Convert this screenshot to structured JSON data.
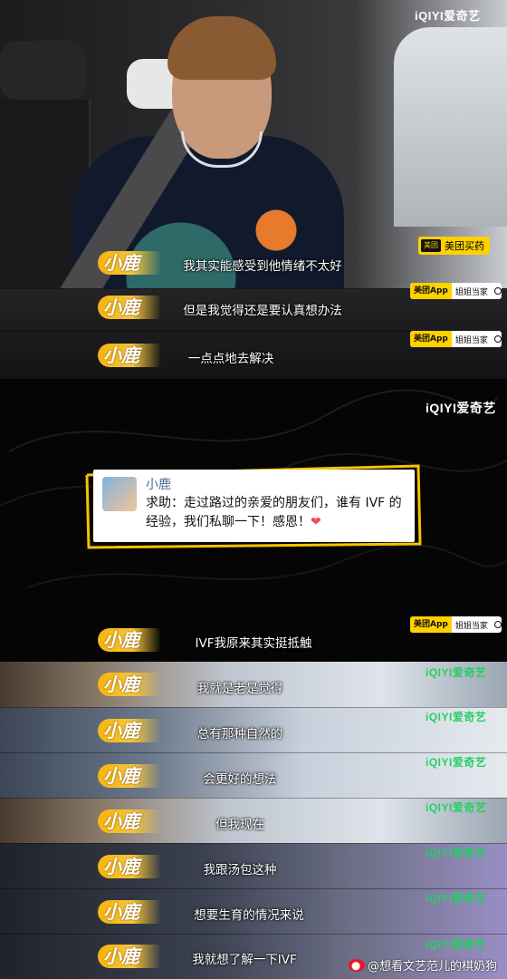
{
  "brand": {
    "iqiyi_prefix": "iQIYI",
    "iqiyi_suffix": "爱奇艺",
    "subtitle_logo": "小鹿"
  },
  "ads": {
    "top_banner": "美团买药",
    "top_banner_badge": "美团",
    "strip_tag": "美团App",
    "strip_search": "姐姐当家"
  },
  "subtitles": [
    "我其实能感受到他情绪不太好",
    "但是我觉得还是要认真想办法",
    "一点点地去解决",
    "IVF我原来其实挺抵触",
    "我就是老是觉得",
    "总有那种自然的",
    "会更好的想法",
    "但我现在",
    "我跟汤包这种",
    "想要生育的情况来说",
    "我就想了解一下IVF"
  ],
  "wechat_post": {
    "author": "小鹿",
    "text": "求助：走过路过的亲爱的朋友们，谁有 IVF 的经验，我们私聊一下！感恩！",
    "emoji": "❤"
  },
  "watermark": "@想看文艺范儿的棋奶狗",
  "colors": {
    "logo_gold": "#f6b40e",
    "meituan_yellow": "#ffd100",
    "iqiyi_green": "#23d160"
  }
}
